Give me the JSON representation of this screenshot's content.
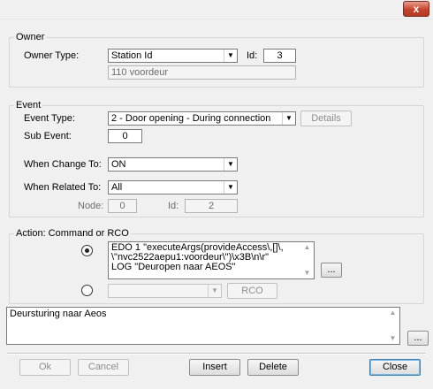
{
  "window": {
    "close_glyph": "x"
  },
  "owner": {
    "legend": "Owner",
    "type_label": "Owner Type:",
    "type_value": "Station Id",
    "id_label": "Id:",
    "id_value": "3",
    "description": "110 voordeur"
  },
  "event": {
    "legend": "Event",
    "type_label": "Event Type:",
    "type_value": "2 - Door opening - During connection",
    "details_label": "Details",
    "sub_event_label": "Sub Event:",
    "sub_event_value": "0",
    "when_change_label": "When Change To:",
    "when_change_value": "ON",
    "when_related_label": "When Related To:",
    "when_related_value": "All",
    "node_label": "Node:",
    "node_value": "0",
    "related_id_label": "Id:",
    "related_id_value": "2"
  },
  "action": {
    "legend": "Action: Command or RCO",
    "command_lines": [
      "EDO 1 \"executeArgs(provideAccess\\,[]\\,",
      "\\\"nvc2522aepu1:voordeur\\\")\\x3B\\n\\r\"",
      "LOG \"Deuropen naar AEOS\""
    ],
    "command_browse_label": "...",
    "rco_value": "",
    "rco_button_label": "RCO"
  },
  "notes": {
    "text": "Deursturing naar Aeos",
    "browse_label": "..."
  },
  "buttons": {
    "ok": "Ok",
    "cancel": "Cancel",
    "insert": "Insert",
    "delete": "Delete",
    "close": "Close"
  },
  "icons": {
    "dropdown": "chevron-down-icon",
    "close": "close-icon"
  }
}
